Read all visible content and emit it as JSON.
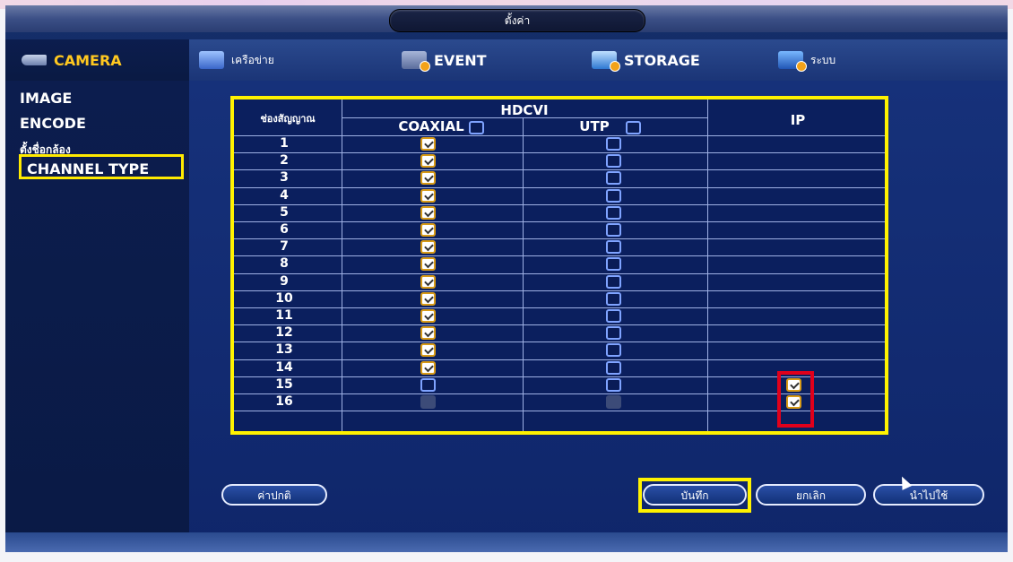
{
  "window": {
    "title": "ตั้งค่า"
  },
  "tabs": [
    {
      "label": "CAMERA",
      "icon": "camera-icon",
      "active": true
    },
    {
      "label": "เครือข่าย",
      "icon": "network-icon"
    },
    {
      "label": "EVENT",
      "icon": "event-icon"
    },
    {
      "label": "STORAGE",
      "icon": "storage-icon"
    },
    {
      "label": "ระบบ",
      "icon": "system-icon"
    }
  ],
  "sidebar": {
    "items": [
      {
        "label": "IMAGE"
      },
      {
        "label": "ENCODE"
      },
      {
        "label": "ตั้งชื่อกล้อง"
      },
      {
        "label": "CHANNEL TYPE",
        "selected": true
      }
    ]
  },
  "table": {
    "channel_header": "ช่องสัญญาณ",
    "hdcvi_header": "HDCVI",
    "coaxial_header": "COAXIAL",
    "utp_header": "UTP",
    "ip_header": "IP",
    "rows": [
      {
        "ch": "1",
        "coaxial": "checked",
        "utp": "unchecked",
        "ip": "none"
      },
      {
        "ch": "2",
        "coaxial": "checked",
        "utp": "unchecked",
        "ip": "none"
      },
      {
        "ch": "3",
        "coaxial": "checked",
        "utp": "unchecked",
        "ip": "none"
      },
      {
        "ch": "4",
        "coaxial": "checked",
        "utp": "unchecked",
        "ip": "none"
      },
      {
        "ch": "5",
        "coaxial": "checked",
        "utp": "unchecked",
        "ip": "none"
      },
      {
        "ch": "6",
        "coaxial": "checked",
        "utp": "unchecked",
        "ip": "none"
      },
      {
        "ch": "7",
        "coaxial": "checked",
        "utp": "unchecked",
        "ip": "none"
      },
      {
        "ch": "8",
        "coaxial": "checked",
        "utp": "unchecked",
        "ip": "none"
      },
      {
        "ch": "9",
        "coaxial": "checked",
        "utp": "unchecked",
        "ip": "none"
      },
      {
        "ch": "10",
        "coaxial": "checked",
        "utp": "unchecked",
        "ip": "none"
      },
      {
        "ch": "11",
        "coaxial": "checked",
        "utp": "unchecked",
        "ip": "none"
      },
      {
        "ch": "12",
        "coaxial": "checked",
        "utp": "unchecked",
        "ip": "none"
      },
      {
        "ch": "13",
        "coaxial": "checked",
        "utp": "unchecked",
        "ip": "none"
      },
      {
        "ch": "14",
        "coaxial": "checked",
        "utp": "unchecked",
        "ip": "none"
      },
      {
        "ch": "15",
        "coaxial": "unchecked",
        "utp": "unchecked",
        "ip": "checked"
      },
      {
        "ch": "16",
        "coaxial": "disabled",
        "utp": "disabled",
        "ip": "checked"
      }
    ]
  },
  "buttons": {
    "default_label": "ค่าปกติ",
    "save_label": "บันทึก",
    "cancel_label": "ยกเลิก",
    "apply_label": "นำไปใช้"
  },
  "colors": {
    "highlight_yellow": "#fff200",
    "highlight_red": "#e0001b",
    "active_tab_text": "#ffc820",
    "background_blue": "#0f266a"
  }
}
